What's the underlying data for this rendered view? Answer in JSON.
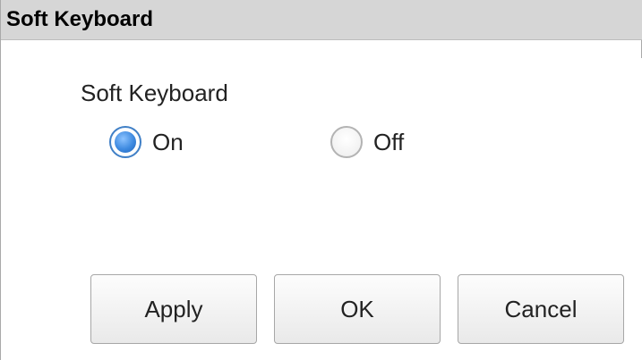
{
  "window": {
    "title": "Soft Keyboard"
  },
  "soft_keyboard": {
    "group_label": "Soft Keyboard",
    "options": [
      {
        "label": "On",
        "selected": true
      },
      {
        "label": "Off",
        "selected": false
      }
    ],
    "selected_value": "On"
  },
  "buttons": {
    "apply_label": "Apply",
    "ok_label": "OK",
    "cancel_label": "Cancel"
  },
  "colors": {
    "title_bar": "#d6d6d6",
    "radio_selected": "#3e8ae0",
    "button_border": "#a7a7a7"
  }
}
